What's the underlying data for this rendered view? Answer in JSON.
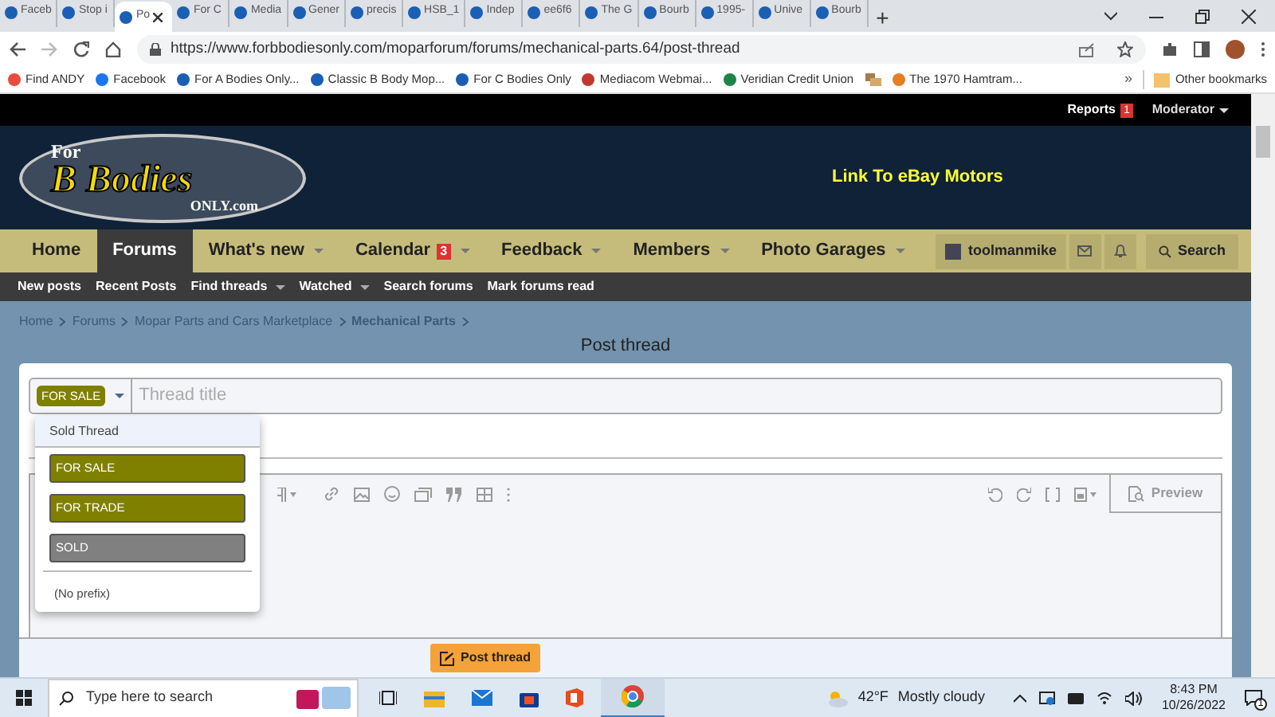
{
  "browser": {
    "tabs": [
      {
        "label": "Faceb",
        "selected": false
      },
      {
        "label": "Stop i",
        "selected": false
      },
      {
        "label": "Po",
        "selected": true
      },
      {
        "label": "For C",
        "selected": false
      },
      {
        "label": "Media",
        "selected": false
      },
      {
        "label": "Gener",
        "selected": false
      },
      {
        "label": "precis",
        "selected": false
      },
      {
        "label": "HSB_1",
        "selected": false
      },
      {
        "label": "Indep",
        "selected": false
      },
      {
        "label": "ee6f6",
        "selected": false
      },
      {
        "label": "The G",
        "selected": false
      },
      {
        "label": "Bourb",
        "selected": false
      },
      {
        "label": "1995-",
        "selected": false
      },
      {
        "label": "Unive",
        "selected": false
      },
      {
        "label": "Bourb",
        "selected": false
      }
    ],
    "new_tab": "+",
    "address": "https://www.forbbodiesonly.com/moparforum/forums/mechanical-parts.64/post-thread",
    "bookmarks": [
      "Find ANDY",
      "Facebook",
      "For A Bodies Only...",
      "Classic B Body Mop...",
      "For C Bodies Only",
      "Mediacom Webmai...",
      "Veridian Credit Union",
      "The 1970 Hamtram..."
    ],
    "bookmarks_overflow": "»",
    "other_bookmarks": "Other bookmarks"
  },
  "site": {
    "top_bar": {
      "reports": "Reports",
      "reports_count": "1",
      "moderator": "Moderator"
    },
    "logo": {
      "line_1": "For",
      "line_2": "B Bodies",
      "line_3": "ONLY.com"
    },
    "header_link": "Link To eBay Motors",
    "nav": [
      {
        "label": "Home",
        "selected": false,
        "dropdown": false
      },
      {
        "label": "Forums",
        "selected": true,
        "dropdown": false
      },
      {
        "label": "What's new",
        "selected": false,
        "dropdown": true
      },
      {
        "label": "Calendar",
        "selected": false,
        "dropdown": true,
        "badge": "3"
      },
      {
        "label": "Feedback",
        "selected": false,
        "dropdown": true
      },
      {
        "label": "Members",
        "selected": false,
        "dropdown": true
      },
      {
        "label": "Photo Garages",
        "selected": false,
        "dropdown": true
      }
    ],
    "user": "toolmanmike",
    "search": "Search",
    "subnav": [
      {
        "label": "New posts",
        "dropdown": false
      },
      {
        "label": "Recent Posts",
        "dropdown": false
      },
      {
        "label": "Find threads",
        "dropdown": true
      },
      {
        "label": "Watched",
        "dropdown": true
      },
      {
        "label": "Search forums",
        "dropdown": false
      },
      {
        "label": "Mark forums read",
        "dropdown": false
      }
    ]
  },
  "breadcrumb": [
    "Home",
    "Forums",
    "Mopar Parts and Cars Marketplace",
    "Mechanical Parts"
  ],
  "page_title": "Post thread",
  "form": {
    "prefix": "FOR SALE",
    "title_placeholder": "Thread title",
    "prefix_menu": {
      "group": "Sold Thread",
      "options": [
        {
          "label": "FOR SALE",
          "color": "#808000"
        },
        {
          "label": "FOR TRADE",
          "color": "#808000"
        },
        {
          "label": "SOLD",
          "color": "#808080"
        }
      ],
      "none": "(No prefix)"
    },
    "preview": "Preview",
    "submit": "Post thread"
  },
  "taskbar": {
    "search_placeholder": "Type here to search",
    "temperature": "42°F",
    "weather": "Mostly cloudy",
    "time": "8:43 PM",
    "date": "10/26/2022",
    "notifications": "1"
  }
}
